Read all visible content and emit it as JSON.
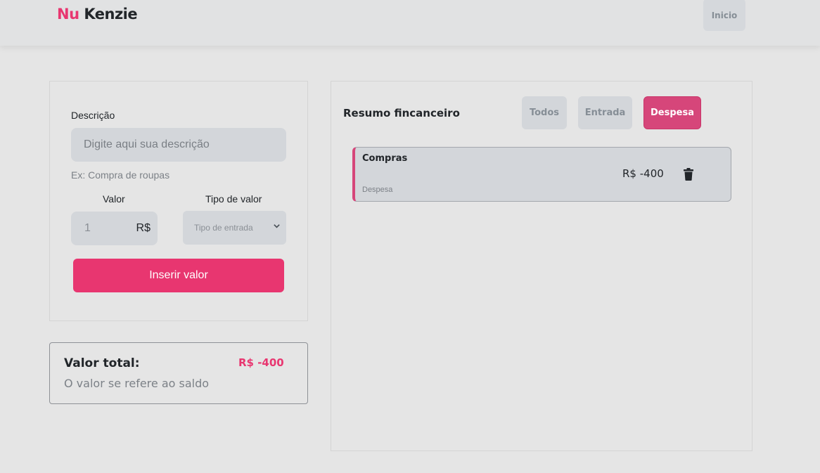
{
  "header": {
    "logo_part1": "Nu",
    "logo_part2": "Kenzie",
    "inicio_label": "Inicio"
  },
  "form": {
    "descricao_label": "Descrição",
    "descricao_placeholder": "Digite aqui sua descrição",
    "descricao_hint": "Ex: Compra de roupas",
    "valor_label": "Valor",
    "valor_value": "1",
    "valor_currency": "R$",
    "tipo_label": "Tipo de valor",
    "tipo_selected": "Tipo de entrada",
    "submit_label": "Inserir valor"
  },
  "total": {
    "label": "Valor total:",
    "value": "R$ -400",
    "subtitle": "O valor se refere ao saldo"
  },
  "summary": {
    "title": "Resumo fincanceiro",
    "filters": [
      {
        "label": "Todos",
        "active": false
      },
      {
        "label": "Entrada",
        "active": false
      },
      {
        "label": "Despesa",
        "active": true
      }
    ],
    "transactions": [
      {
        "description": "Compras",
        "type": "Despesa",
        "value": "R$ -400",
        "icon": "trash-icon"
      }
    ]
  },
  "colors": {
    "brand": "#e83670",
    "active_filter": "#d6467a",
    "background": "#e5e5e5",
    "input_bg": "#d3d6da"
  }
}
